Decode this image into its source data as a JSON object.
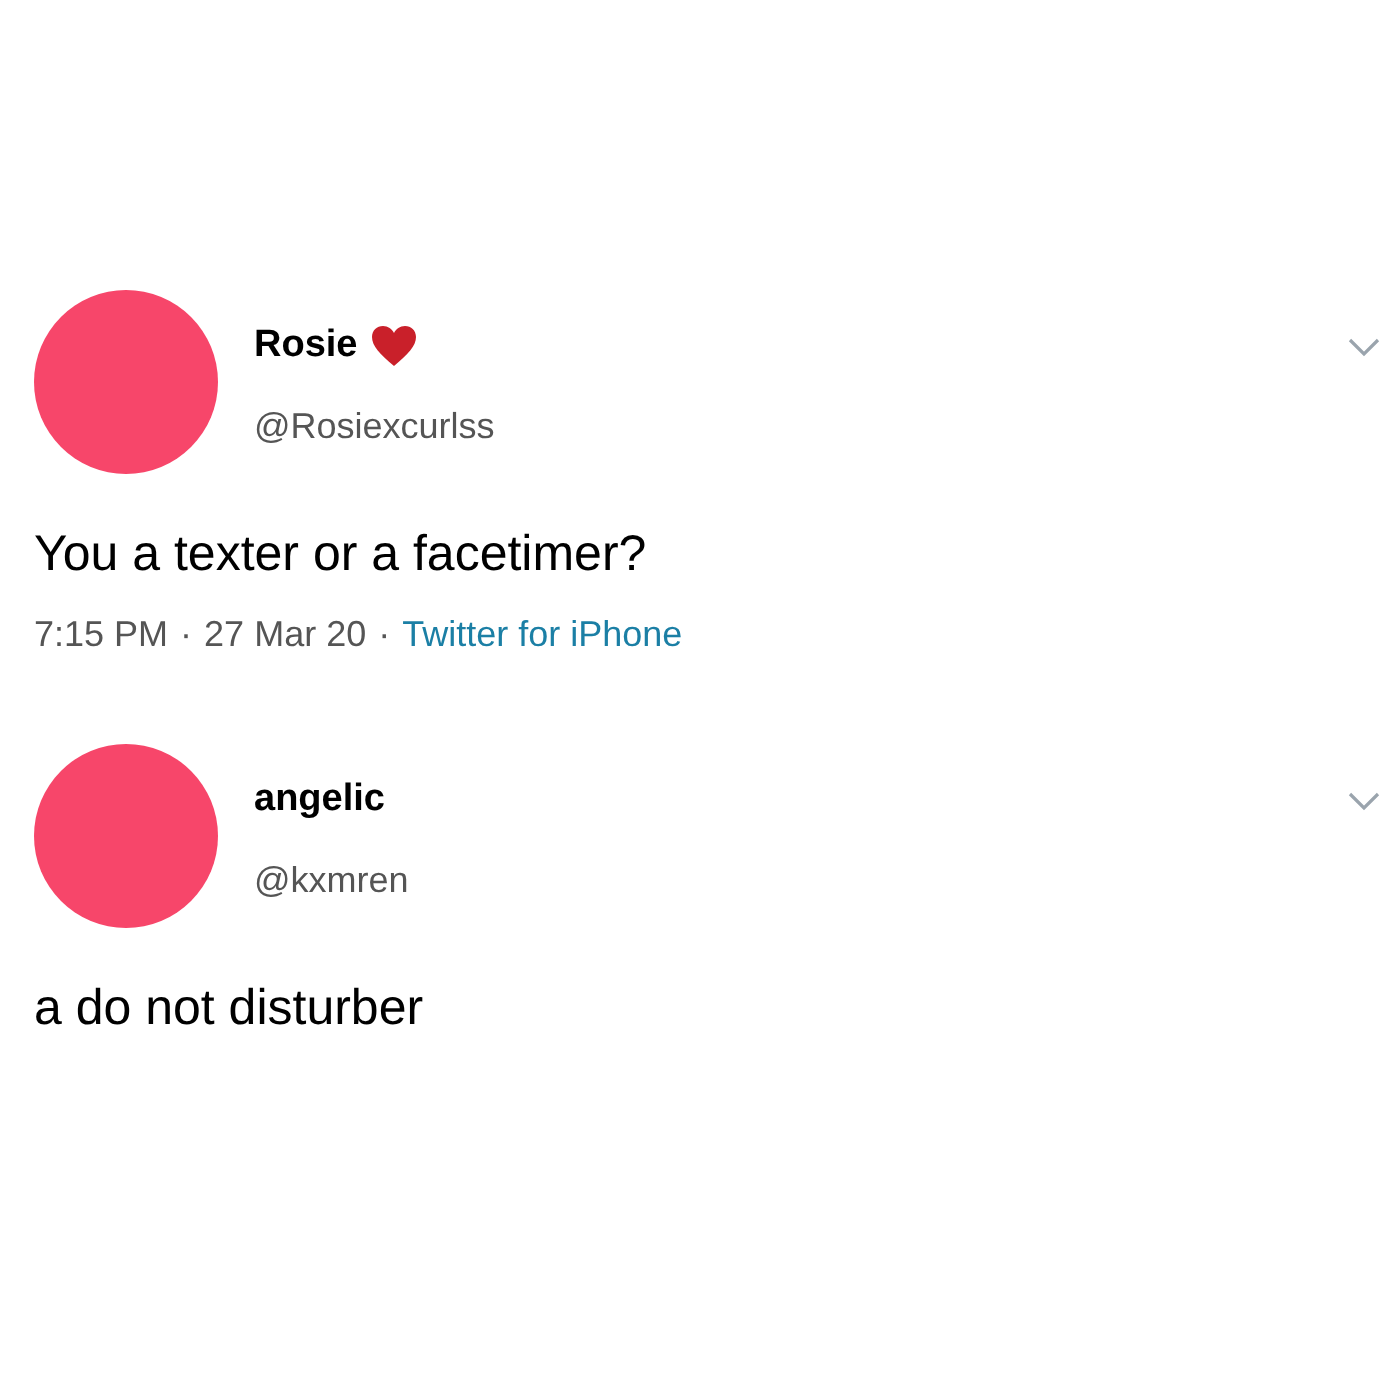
{
  "tweets": [
    {
      "name": "Rosie",
      "heart": true,
      "handle": "@Rosiexcurlss",
      "text": "You a texter or a facetimer?",
      "meta": [
        {
          "kind": "plain",
          "text": "7:15 PM"
        },
        {
          "kind": "plain",
          "text": "·"
        },
        {
          "kind": "plain",
          "text": "27 Mar 20"
        },
        {
          "kind": "plain",
          "text": "·"
        },
        {
          "kind": "link",
          "text": "Twitter for iPhone"
        }
      ]
    },
    {
      "name": "angelic",
      "heart": false,
      "handle": "@kxmren",
      "text": "a do not disturber"
    }
  ]
}
